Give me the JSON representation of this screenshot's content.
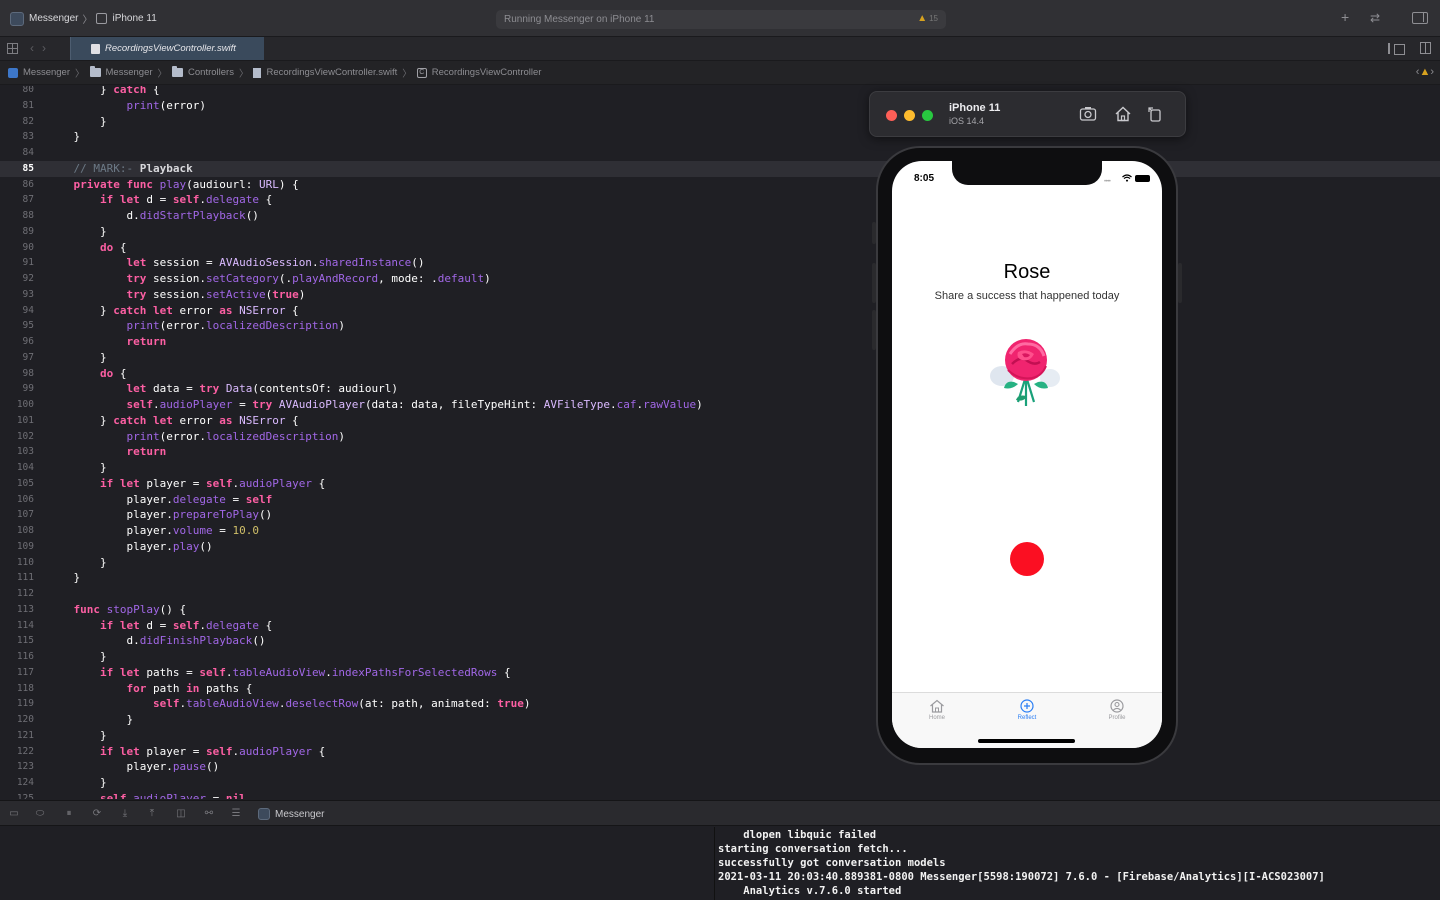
{
  "toolbar": {
    "scheme": "Messenger",
    "device": "iPhone 11",
    "status": "Running Messenger on iPhone 11",
    "warning_count": "15"
  },
  "tab": {
    "filename": "RecordingsViewController.swift"
  },
  "jumpbar": {
    "items": [
      "Messenger",
      "Messenger",
      "Controllers",
      "RecordingsViewController.swift",
      "RecordingsViewController"
    ]
  },
  "editor": {
    "highlighted_line": 85,
    "line_numbers": [
      "80",
      "81",
      "82",
      "83",
      "84",
      "85",
      "86",
      "87",
      "88",
      "89",
      "90",
      "91",
      "92",
      "93",
      "94",
      "95",
      "96",
      "97",
      "98",
      "99",
      "100",
      "101",
      "102",
      "103",
      "104",
      "105",
      "106",
      "107",
      "108",
      "109",
      "110",
      "111",
      "112",
      "113",
      "114",
      "115",
      "116",
      "117",
      "118",
      "119",
      "120",
      "121",
      "122",
      "123",
      "124",
      "125"
    ]
  },
  "simulator": {
    "device_name": "iPhone 11",
    "os_version": "iOS 14.4",
    "buttons": [
      "screenshot-icon",
      "home-icon",
      "rotate-icon"
    ]
  },
  "app": {
    "time": "8:05",
    "title": "Rose",
    "subtitle": "Share a success that happened today",
    "record_color": "#fb0f22",
    "tabs": [
      {
        "label": "Home",
        "icon": "house-icon",
        "active": false
      },
      {
        "label": "Reflect",
        "icon": "plus-circle-icon",
        "active": true
      },
      {
        "label": "Profile",
        "icon": "person-circle-icon",
        "active": false
      }
    ]
  },
  "debugbar": {
    "target": "Messenger"
  },
  "console": {
    "lines": [
      "    dlopen libquic failed",
      "starting conversation fetch...",
      "successfully got conversation models",
      "2021-03-11 20:03:40.889381-0800 Messenger[5598:190072] 7.6.0 - [Firebase/Analytics][I-ACS023007]",
      "    Analytics v.7.6.0 started"
    ]
  },
  "colors": {
    "editor_bg": "#1f1f24",
    "keyword": "#fc5fa3",
    "type": "#dabaff",
    "function": "#a167e6",
    "comment": "#6c7986",
    "number": "#d0bf69",
    "accent": "#2a7ef4"
  }
}
